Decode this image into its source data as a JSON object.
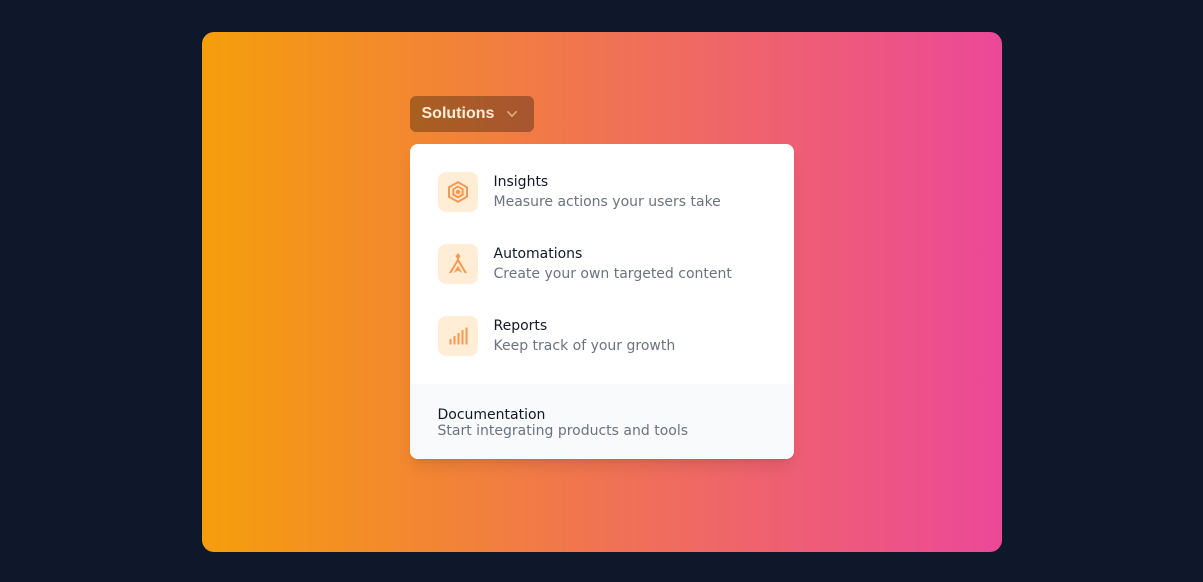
{
  "dropdown": {
    "label": "Solutions"
  },
  "menu": {
    "items": [
      {
        "title": "Insights",
        "description": "Measure actions your users take"
      },
      {
        "title": "Automations",
        "description": "Create your own targeted content"
      },
      {
        "title": "Reports",
        "description": "Keep track of your growth"
      }
    ],
    "documentation": {
      "title": "Documentation",
      "description": "Start integrating products and tools"
    }
  }
}
